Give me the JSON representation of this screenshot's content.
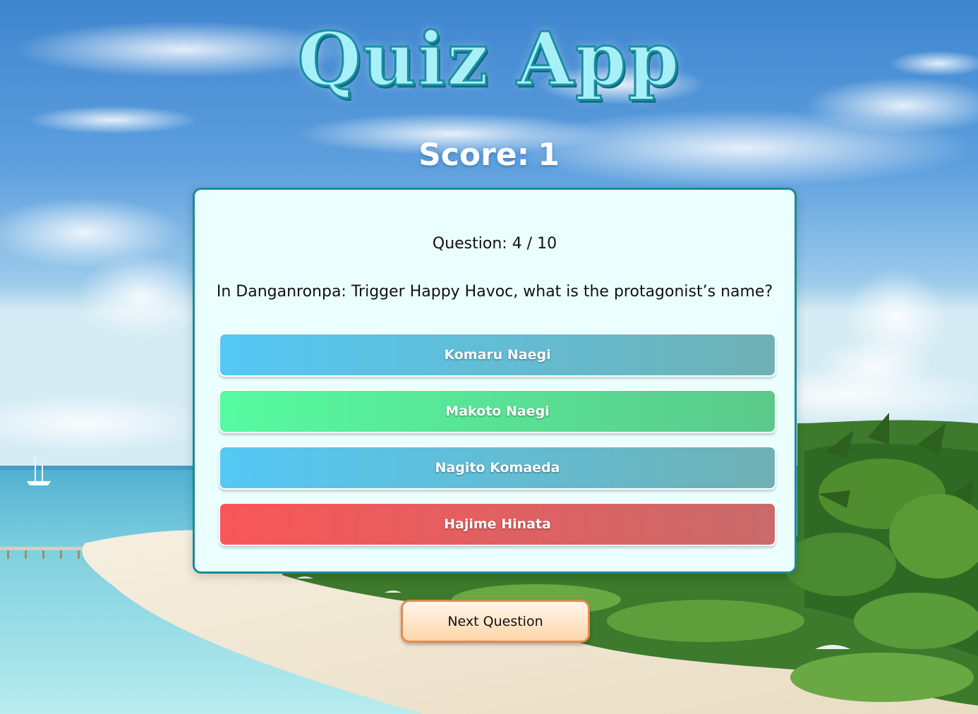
{
  "app": {
    "title": "Quiz App"
  },
  "score": {
    "label": "Score:",
    "value": "1"
  },
  "quiz": {
    "question_number": "Question: 4 / 10",
    "question_text": "In Danganronpa: Trigger Happy Havoc, what is the protagonist’s name?",
    "answers": [
      {
        "label": "Komaru Naegi",
        "state": "neutral"
      },
      {
        "label": "Makoto Naegi",
        "state": "correct"
      },
      {
        "label": "Nagito Komaeda",
        "state": "neutral"
      },
      {
        "label": "Hajime Hinata",
        "state": "wrong"
      }
    ]
  },
  "controls": {
    "next_label": "Next Question"
  },
  "colors": {
    "card_bg": "#ebffff",
    "card_border": "#1b8a97",
    "neutral": "#55c8f5",
    "correct": "#56fba0",
    "wrong": "#f85658",
    "next_border": "#e28a4d"
  }
}
